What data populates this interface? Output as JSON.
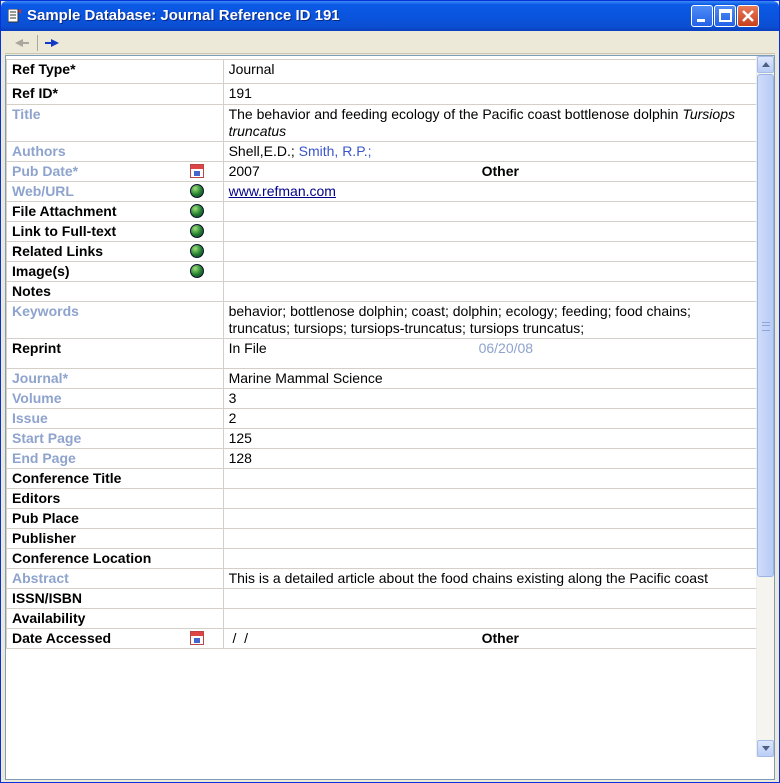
{
  "window": {
    "title": "Sample Database: Journal Reference ID 191"
  },
  "toolbar": {
    "prev_icon": "arrow-left-icon",
    "next_icon": "arrow-right-icon"
  },
  "fields": [
    {
      "label": "Ref Type*",
      "value": "Journal"
    },
    {
      "label": "Ref ID*",
      "value": "191"
    },
    {
      "label": "Title",
      "value_main": "The behavior and feeding ecology of the Pacific coast bottlenose dolphin ",
      "value_italic": "Tursiops truncatus"
    },
    {
      "label": "Authors",
      "value": "Shell,E.D.; ",
      "value_link": "Smith, R.P.;"
    },
    {
      "label": "Pub Date*",
      "value": "2007",
      "extra": "Other",
      "icon": "calendar-icon"
    },
    {
      "label": "Web/URL",
      "value": "www.refman.com",
      "icon": "globe-icon"
    },
    {
      "label": "File Attachment",
      "value": "",
      "icon": "globe-icon"
    },
    {
      "label": "Link to Full-text",
      "value": "",
      "icon": "globe-icon"
    },
    {
      "label": "Related Links",
      "value": "",
      "icon": "globe-icon"
    },
    {
      "label": "Image(s)",
      "value": "",
      "icon": "globe-icon"
    },
    {
      "label": "Notes",
      "value": ""
    },
    {
      "label": "Keywords",
      "value": "behavior; bottlenose dolphin; coast; dolphin; ecology; feeding; food chains; truncatus; tursiops; tursiops-truncatus; tursiops truncatus;"
    },
    {
      "label": "Reprint",
      "value": "In File",
      "extra": "06/20/08"
    },
    {
      "label": "Journal*",
      "value": "Marine Mammal Science"
    },
    {
      "label": "Volume",
      "value": "3"
    },
    {
      "label": "Issue",
      "value": "2"
    },
    {
      "label": "Start Page",
      "value": "125"
    },
    {
      "label": "End Page",
      "value": "128"
    },
    {
      "label": "Conference Title",
      "value": ""
    },
    {
      "label": "Editors",
      "value": ""
    },
    {
      "label": "Pub Place",
      "value": ""
    },
    {
      "label": "Publisher",
      "value": ""
    },
    {
      "label": "Conference Location",
      "value": ""
    },
    {
      "label": "Abstract",
      "value": "This is a detailed article about the food chains existing along the Pacific coast"
    },
    {
      "label": "ISSN/ISBN",
      "value": ""
    },
    {
      "label": "Availability",
      "value": ""
    },
    {
      "label": "Date Accessed",
      "value": " /  /",
      "extra": "Other",
      "icon": "calendar-icon"
    }
  ],
  "colors": {
    "link_label": "#8ea3cd",
    "title_bar": "#0a54de"
  }
}
